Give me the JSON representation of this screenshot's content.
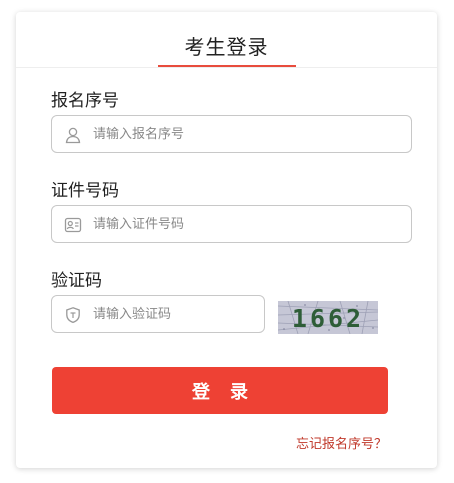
{
  "header": {
    "title": "考生登录"
  },
  "form": {
    "reg_number": {
      "label": "报名序号",
      "placeholder": "请输入报名序号",
      "value": ""
    },
    "id_number": {
      "label": "证件号码",
      "placeholder": "请输入证件号码",
      "value": ""
    },
    "captcha": {
      "label": "验证码",
      "placeholder": "请输入验证码",
      "value": "",
      "image_text": "1662"
    },
    "login_label": "登录",
    "forgot_link": "忘记报名序号？"
  },
  "icons": {
    "reg_number": "user-icon",
    "id_number": "id-card-icon",
    "captcha": "shield-icon"
  },
  "colors": {
    "accent": "#ee4134",
    "link": "#c0392b",
    "border": "#c8c8c8"
  }
}
